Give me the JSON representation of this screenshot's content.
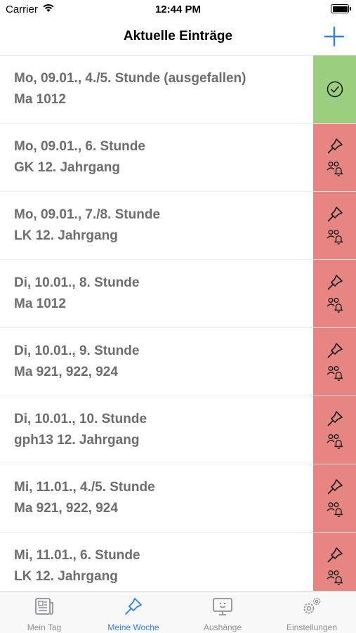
{
  "status_bar": {
    "carrier": "Carrier",
    "time": "12:44 PM"
  },
  "nav": {
    "title": "Aktuelle Einträge"
  },
  "entries": [
    {
      "line1": "Mo, 09.01., 4./5. Stunde (ausgefallen)",
      "line2": "Ma 1012",
      "state": "done"
    },
    {
      "line1": "Mo, 09.01., 6. Stunde",
      "line2": "GK 12. Jahrgang",
      "state": "open"
    },
    {
      "line1": "Mo, 09.01., 7./8. Stunde",
      "line2": "LK 12. Jahrgang",
      "state": "open"
    },
    {
      "line1": "Di, 10.01., 8. Stunde",
      "line2": "Ma 1012",
      "state": "open"
    },
    {
      "line1": "Di, 10.01., 9. Stunde",
      "line2": "Ma 921, 922, 924",
      "state": "open"
    },
    {
      "line1": "Di, 10.01., 10. Stunde",
      "line2": "gph13 12. Jahrgang",
      "state": "open"
    },
    {
      "line1": "Mi, 11.01., 4./5. Stunde",
      "line2": "Ma 921, 922, 924",
      "state": "open"
    },
    {
      "line1": "Mi, 11.01., 6. Stunde",
      "line2": "LK 12. Jahrgang",
      "state": "open"
    }
  ],
  "tabs": [
    {
      "label": "Mein Tag",
      "icon": "newspaper-icon",
      "active": false
    },
    {
      "label": "Meine Woche",
      "icon": "pin-icon",
      "active": true
    },
    {
      "label": "Aushänge",
      "icon": "display-icon",
      "active": false
    },
    {
      "label": "Einstellungen",
      "icon": "gears-icon",
      "active": false
    }
  ],
  "colors": {
    "accent": "#2f7ff0",
    "done": "#9bcf7e",
    "open": "#e78583",
    "entry_text": "#6d6d6d",
    "tab_inactive": "#8e8e93"
  }
}
